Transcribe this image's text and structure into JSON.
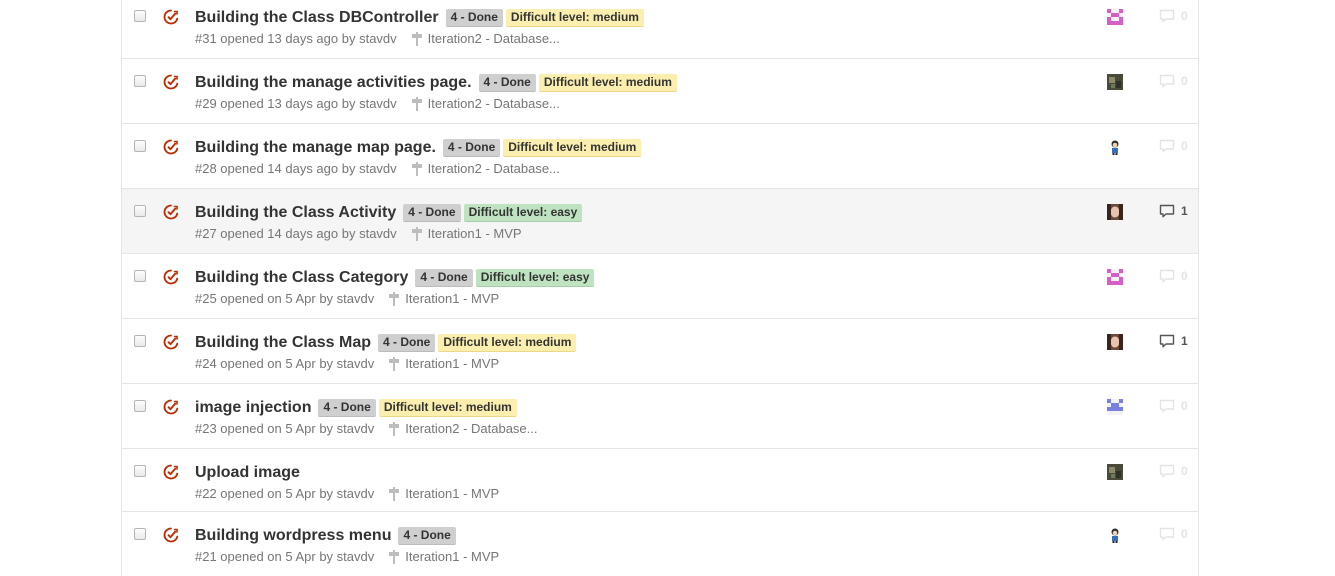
{
  "issues": [
    {
      "title": "Building the Class DBController",
      "labels": [
        {
          "text": "4 - Done",
          "kind": "done"
        },
        {
          "text": "Difficult level: medium",
          "kind": "medium"
        }
      ],
      "meta": "#31 opened 13 days ago by stavdv",
      "milestone": "Iteration2 - Database...",
      "comments": "0",
      "avatar": "pink-identicon"
    },
    {
      "title": "Building the manage activities page.",
      "labels": [
        {
          "text": "4 - Done",
          "kind": "done"
        },
        {
          "text": "Difficult level: medium",
          "kind": "medium"
        }
      ],
      "meta": "#29 opened 13 days ago by stavdv",
      "milestone": "Iteration2 - Database...",
      "comments": "0",
      "avatar": "photo-dark"
    },
    {
      "title": "Building the manage map page.",
      "labels": [
        {
          "text": "4 - Done",
          "kind": "done"
        },
        {
          "text": "Difficult level: medium",
          "kind": "medium"
        }
      ],
      "meta": "#28 opened 14 days ago by stavdv",
      "milestone": "Iteration2 - Database...",
      "comments": "0",
      "avatar": "cartoon-figure"
    },
    {
      "title": "Building the Class Activity",
      "labels": [
        {
          "text": "4 - Done",
          "kind": "done"
        },
        {
          "text": "Difficult level: easy",
          "kind": "easy"
        }
      ],
      "meta": "#27 opened 14 days ago by stavdv",
      "milestone": "Iteration1 - MVP",
      "comments": "1",
      "avatar": "photo-face"
    },
    {
      "title": "Building the Class Category",
      "labels": [
        {
          "text": "4 - Done",
          "kind": "done"
        },
        {
          "text": "Difficult level: easy",
          "kind": "easy"
        }
      ],
      "meta": "#25 opened on 5 Apr by stavdv",
      "milestone": "Iteration1 - MVP",
      "comments": "0",
      "avatar": "pink-identicon"
    },
    {
      "title": "Building the Class Map",
      "labels": [
        {
          "text": "4 - Done",
          "kind": "done"
        },
        {
          "text": "Difficult level: medium",
          "kind": "medium"
        }
      ],
      "meta": "#24 opened on 5 Apr by stavdv",
      "milestone": "Iteration1 - MVP",
      "comments": "1",
      "avatar": "photo-face"
    },
    {
      "title": "image injection",
      "labels": [
        {
          "text": "4 - Done",
          "kind": "done"
        },
        {
          "text": "Difficult level: medium",
          "kind": "medium"
        }
      ],
      "meta": "#23 opened on 5 Apr by stavdv",
      "milestone": "Iteration2 - Database...",
      "comments": "0",
      "avatar": "blue-identicon"
    },
    {
      "title": "Upload image",
      "labels": [],
      "meta": "#22 opened on 5 Apr by stavdv",
      "milestone": "Iteration1 - MVP",
      "comments": "0",
      "avatar": "photo-dark"
    },
    {
      "title": "Building wordpress menu",
      "labels": [
        {
          "text": "4 - Done",
          "kind": "done"
        }
      ],
      "meta": "#21 opened on 5 Apr by stavdv",
      "milestone": "Iteration1 - MVP",
      "comments": "0",
      "avatar": "cartoon-figure"
    }
  ],
  "colors": {
    "closed_icon": "#bd2c00",
    "label_done": "#cfcfcf",
    "label_medium": "#fbefb0",
    "label_easy": "#bfe3c1"
  }
}
